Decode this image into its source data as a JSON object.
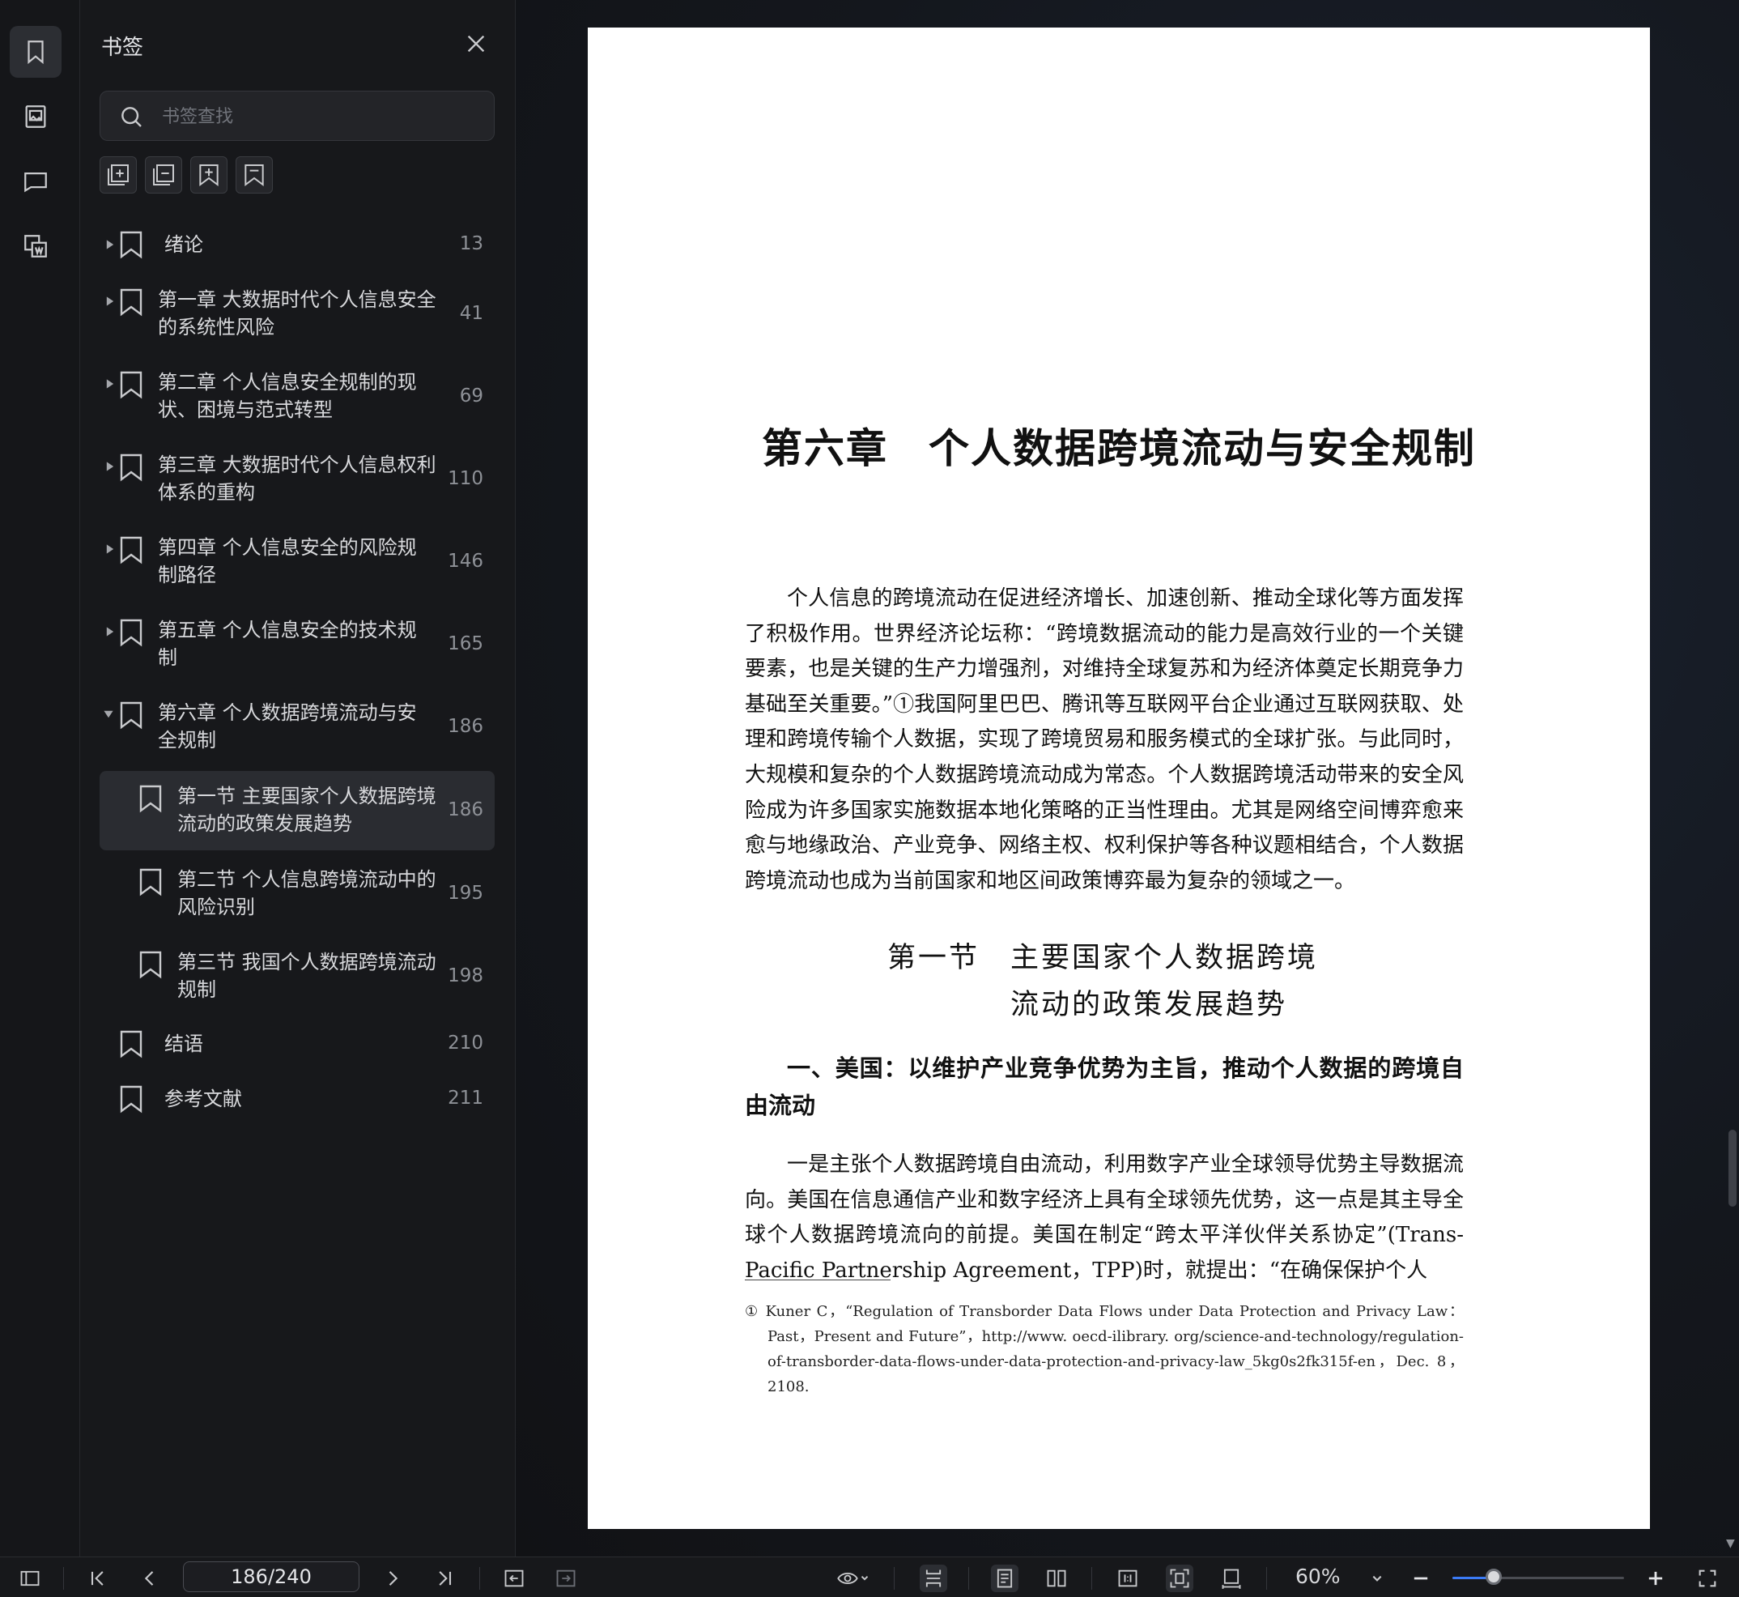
{
  "panel": {
    "title": "书签",
    "search_placeholder": "书签查找"
  },
  "bookmarks": [
    {
      "label": "绪论",
      "page": "13"
    },
    {
      "label": "第一章 大数据时代个人信息安全的系统性风险",
      "page": "41"
    },
    {
      "label": "第二章 个人信息安全规制的现状、困境与范式转型",
      "page": "69"
    },
    {
      "label": "第三章 大数据时代个人信息权利体系的重构",
      "page": "110"
    },
    {
      "label": "第四章 个人信息安全的风险规制路径",
      "page": "146"
    },
    {
      "label": "第五章 个人信息安全的技术规制",
      "page": "165"
    },
    {
      "label": "第六章 个人数据跨境流动与安全规制",
      "page": "186"
    },
    {
      "label": "第一节 主要国家个人数据跨境流动的政策发展趋势",
      "page": "186"
    },
    {
      "label": "第二节 个人信息跨境流动中的风险识别",
      "page": "195"
    },
    {
      "label": "第三节 我国个人数据跨境流动规制",
      "page": "198"
    },
    {
      "label": "结语",
      "page": "210"
    },
    {
      "label": "参考文献",
      "page": "211"
    }
  ],
  "document": {
    "chapter_no": "第六章",
    "chapter_title": "个人数据跨境流动与安全规制",
    "paragraph1": "个人信息的跨境流动在促进经济增长、加速创新、推动全球化等方面发挥了积极作用。世界经济论坛称：“跨境数据流动的能力是高效行业的一个关键要素，也是关键的生产力增强剂，对维持全球复苏和为经济体奠定长期竞争力基础至关重要。”①我国阿里巴巴、腾讯等互联网平台企业通过互联网获取、处理和跨境传输个人数据，实现了跨境贸易和服务模式的全球扩张。与此同时，大规模和复杂的个人数据跨境流动成为常态。个人数据跨境活动带来的安全风险成为许多国家实施数据本地化策略的正当性理由。尤其是网络空间博弈愈来愈与地缘政治、产业竞争、网络主权、权利保护等各种议题相结合，个人数据跨境流动也成为当前国家和地区间政策博弈最为复杂的领域之一。",
    "section_line1": "第一节　主要国家个人数据跨境",
    "section_line2": "流动的政策发展趋势",
    "subheading": "一、美国：以维护产业竞争优势为主旨，推动个人数据的跨境自由流动",
    "paragraph2": "一是主张个人数据跨境自由流动，利用数字产业全球领导优势主导数据流向。美国在信息通信产业和数字经济上具有全球领先优势，这一点是其主导全球个人数据跨境流向的前提。美国在制定“跨太平洋伙伴关系协定”(Trans-Pacific Partnership Agreement，TPP)时，就提出：“在确保保护个人",
    "footnote": "① Kuner C，“Regulation of Transborder Data Flows under Data Protection and Privacy Law：Past，Present and Future”，http://www. oecd-ilibrary. org/science-and-technology/regulation-of-transborder-data-flows-under-data-protection-and-privacy-law_5kg0s2fk315f-en，Dec. 8，2108."
  },
  "toolbar": {
    "page_indicator": "186/240",
    "zoom": "60%",
    "zoom_fraction": 0.24
  },
  "colors": {
    "accent": "#3b7bf6"
  }
}
